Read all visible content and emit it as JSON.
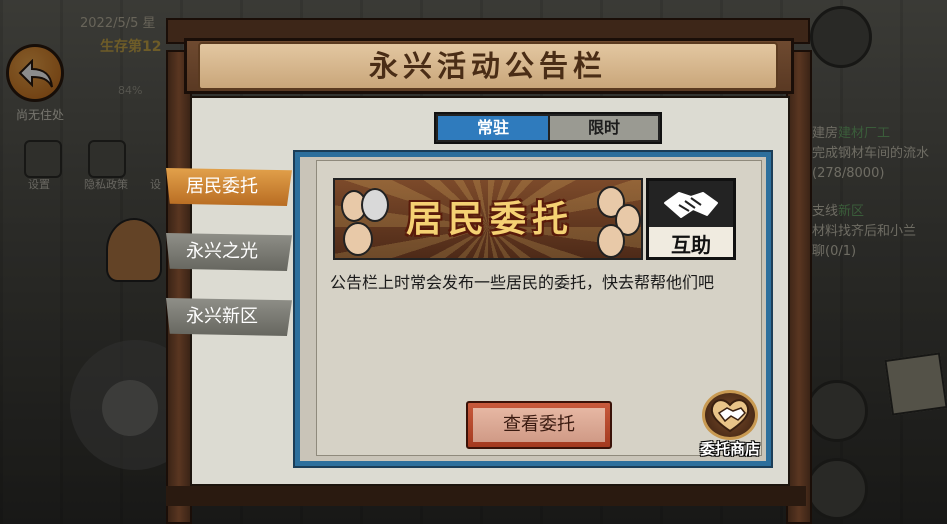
{
  "hud": {
    "date": "2022/5/5 星",
    "day_text": "生存第12",
    "percent": "84%",
    "back_label": "尚无住处",
    "settings_label": "设置",
    "privacy_label": "隐私政策",
    "third_label": "设"
  },
  "quests": [
    {
      "prefix": "建房",
      "highlight": "建材厂工",
      "line2": "完成钢材车间的流水",
      "line3": "(278/8000)"
    },
    {
      "prefix": "支线",
      "highlight": "新区",
      "line2": "材料找齐后和小兰",
      "line3": "聊(0/1)"
    }
  ],
  "board": {
    "title": "永兴活动公告栏",
    "tabs": [
      {
        "label": "常驻",
        "active": true
      },
      {
        "label": "限时",
        "active": false
      }
    ],
    "categories": [
      {
        "label": "居民委托",
        "active": true
      },
      {
        "label": "永兴之光",
        "active": false
      },
      {
        "label": "永兴新区",
        "active": false
      }
    ],
    "banner_title": "居民委托",
    "mutual_label": "互助",
    "description": "公告栏上时常会发布一些居民的委托，快去帮帮他们吧",
    "view_button": "查看委托",
    "shop_label": "委托商店"
  },
  "colors": {
    "tab_active": "#2f7bbd",
    "category_active": "#d28a3a",
    "button": "#b4452a",
    "card_border": "#2d6f9c"
  },
  "icons": [
    "back-arrow-icon",
    "handshake-icon",
    "heart-handshake-icon",
    "gear-icon",
    "document-icon",
    "trophy-icon",
    "clipboard-icon"
  ]
}
